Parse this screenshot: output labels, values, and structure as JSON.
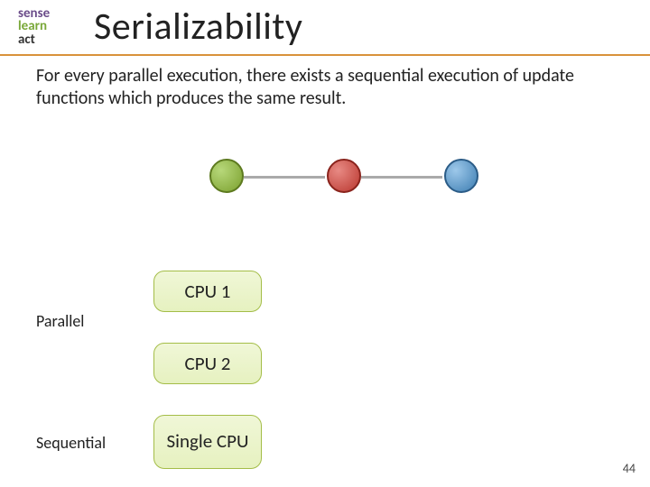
{
  "logo": {
    "line1": "sense",
    "line2": "learn",
    "line3": "act"
  },
  "title": "Serializability",
  "body": "For every parallel execution, there exists a sequential execution of update functions which produces the same result.",
  "labels": {
    "parallel": "Parallel",
    "sequential": "Sequential"
  },
  "boxes": {
    "cpu1": "CPU 1",
    "cpu2": "CPU 2",
    "single": "Single CPU"
  },
  "nodes": {
    "a": "green",
    "b": "red",
    "c": "blue"
  },
  "page_number": "44"
}
